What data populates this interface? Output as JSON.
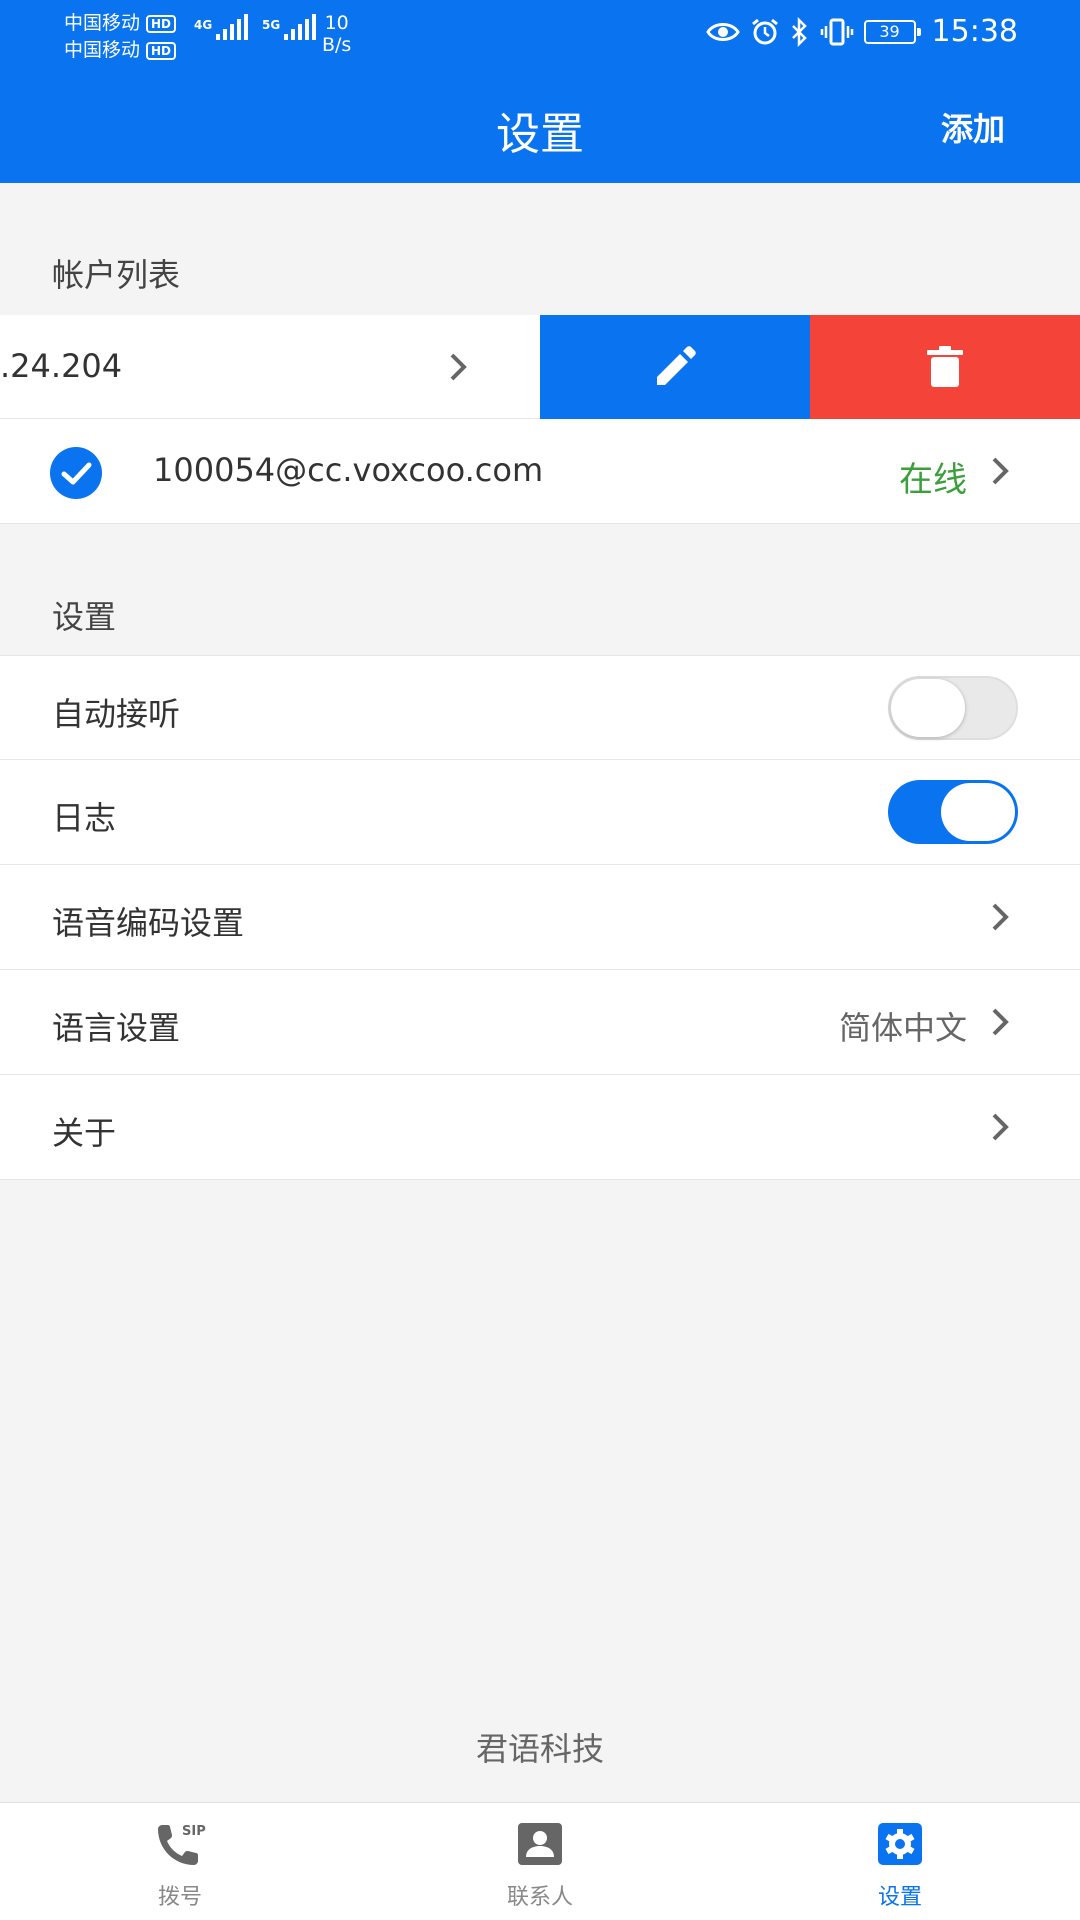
{
  "status_bar": {
    "carrier1": "中国移动",
    "carrier2": "中国移动",
    "hd": "HD",
    "net1": "4G",
    "net2": "5G",
    "speed_value": "10",
    "speed_unit": "B/s",
    "battery": "39",
    "time": "15:38"
  },
  "header": {
    "title": "设置",
    "add_label": "添加"
  },
  "accounts": {
    "section_title": "帐户列表",
    "swiped_item_text": ".24.204",
    "items": [
      {
        "address": "100054@cc.voxcoo.com",
        "status": "在线"
      }
    ]
  },
  "settings": {
    "section_title": "设置",
    "auto_answer_label": "自动接听",
    "auto_answer_on": false,
    "log_label": "日志",
    "log_on": true,
    "codec_label": "语音编码设置",
    "language_label": "语言设置",
    "language_value": "简体中文",
    "about_label": "关于"
  },
  "footer": {
    "brand": "君语科技"
  },
  "bottom_nav": {
    "items": [
      {
        "label": "拨号",
        "icon": "phone-sip-icon"
      },
      {
        "label": "联系人",
        "icon": "contact-icon"
      },
      {
        "label": "设置",
        "icon": "gear-icon"
      }
    ],
    "active_index": 2
  },
  "colors": {
    "primary": "#0a73f0",
    "delete": "#f44338",
    "online": "#3c9f3c",
    "background": "#f4f4f4"
  }
}
